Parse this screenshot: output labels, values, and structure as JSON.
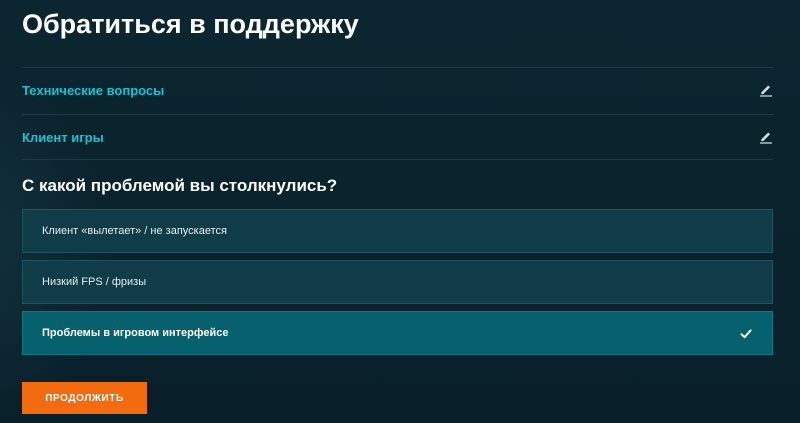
{
  "title": "Обратиться в поддержку",
  "steps": [
    {
      "label": "Технические вопросы",
      "icon": "pencil-icon"
    },
    {
      "label": "Клиент игры",
      "icon": "pencil-icon"
    }
  ],
  "question": "С какой проблемой вы столкнулись?",
  "options": [
    {
      "label": "Клиент «вылетает» / не запускается",
      "selected": false
    },
    {
      "label": "Низкий FPS / фризы",
      "selected": false
    },
    {
      "label": "Проблемы в игровом интерфейсе",
      "selected": true,
      "icon": "checkmark-icon"
    }
  ],
  "continue_label": "ПРОДОЛЖИТЬ",
  "colors": {
    "background": "#0a212b",
    "accent_cyan": "#17c2d2",
    "option_bg": "#0f3c47",
    "option_selected_bg": "#07606e",
    "button_orange": "#f26b0f"
  }
}
